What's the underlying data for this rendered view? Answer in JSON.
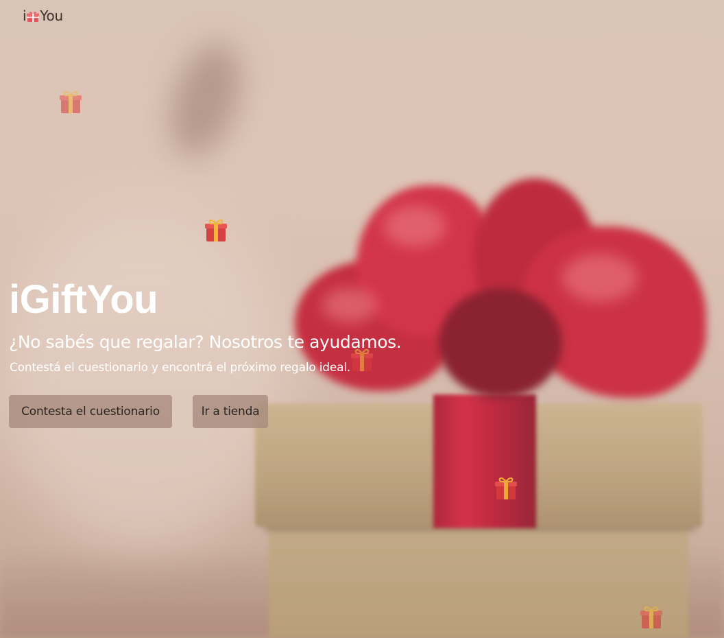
{
  "navbar": {
    "brand_prefix": "i",
    "brand_suffix": "You",
    "brand_icon": "gift-icon"
  },
  "hero": {
    "title": "iGiftYou",
    "subtitle": "¿No sabés que regalar? Nosotros te ayudamos.",
    "description": "Contestá el cuestionario y encontrá el próximo regalo ideal."
  },
  "buttons": {
    "quiz_label": "Contesta el cuestionario",
    "shop_label": "Ir a tienda"
  },
  "floating_gifts": {
    "icon": "wrapped-gift-icon",
    "count": 5
  },
  "colors": {
    "title_text": "#ffffff",
    "button_bg": "#a68a7c",
    "button_text": "#2d2420",
    "brand_text": "#3a302c",
    "gift_red": "#d63b3b",
    "gift_ribbon": "#f2b53a"
  }
}
